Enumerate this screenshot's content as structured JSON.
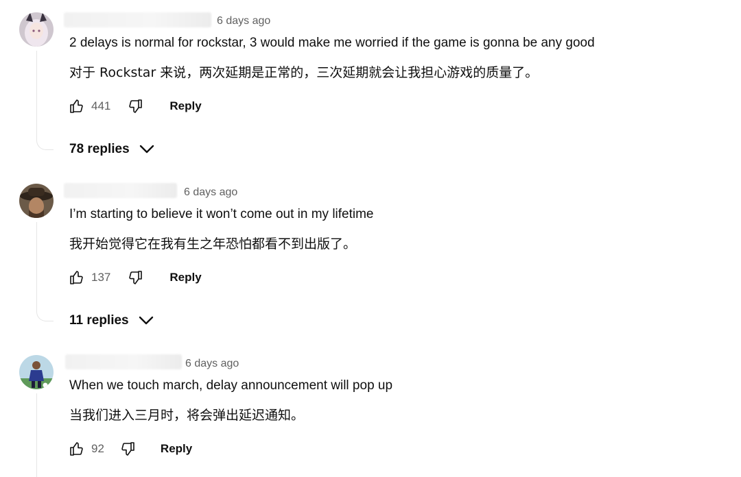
{
  "comments": [
    {
      "time": "6 days ago",
      "text_en": "2 delays is normal for rockstar, 3 would make me worried if the game is gonna be any good",
      "text_zh": "对于 Rockstar 来说，两次延期是正常的，三次延期就会让我担心游戏的质量了。",
      "likes": "441",
      "reply_label": "Reply",
      "replies_label": "78 replies",
      "avatar_icon": "anime-girl-avatar"
    },
    {
      "time": "6 days ago",
      "text_en": "I’m starting to believe it won’t come out in my lifetime",
      "text_zh": "我开始觉得它在我有生之年恐怕都看不到出版了。",
      "likes": "137",
      "reply_label": "Reply",
      "replies_label": "11 replies",
      "avatar_icon": "cowboy-avatar"
    },
    {
      "time": "6 days ago",
      "text_en": "When we touch march, delay announcement will pop up",
      "text_zh": "当我们进入三月时，将会弹出延迟通知。",
      "likes": "92",
      "reply_label": "Reply",
      "avatar_icon": "soccer-player-avatar"
    }
  ],
  "colors": {
    "text": "#0f0f0f",
    "secondary": "#606060",
    "thread_line": "#e5e5e5"
  }
}
